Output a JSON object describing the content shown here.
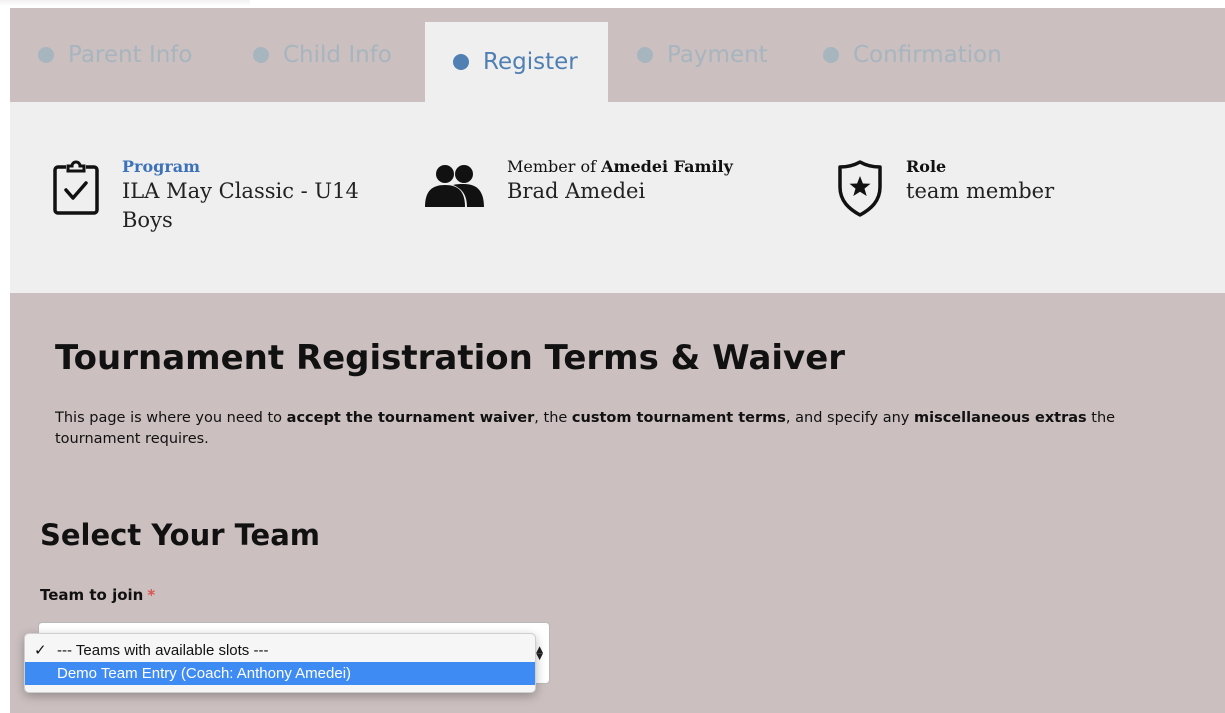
{
  "steps": [
    {
      "label": "Parent Info",
      "active": false
    },
    {
      "label": "Child Info",
      "active": false
    },
    {
      "label": "Register",
      "active": true
    },
    {
      "label": "Payment",
      "active": false
    },
    {
      "label": "Confirmation",
      "active": false
    }
  ],
  "info": {
    "program": {
      "label": "Program",
      "value": "ILA May Classic - U14 Boys",
      "icon": "clipboard-check-icon"
    },
    "member": {
      "prefix": "Member of",
      "family": "Amedei Family",
      "name": "Brad Amedei",
      "icon": "users-icon"
    },
    "role": {
      "label": "Role",
      "value": "team member",
      "icon": "shield-star-icon"
    }
  },
  "main": {
    "title": "Tournament Registration Terms & Waiver",
    "intro": {
      "t1": "This page is where you need to ",
      "b1": "accept the tournament waiver",
      "t2": ", the ",
      "b2": "custom tournament terms",
      "t3": ", and specify any ",
      "b3": "miscellaneous extras",
      "t4": " the tournament requires."
    },
    "section_title": "Select Your Team",
    "field_label": "Team to join",
    "required_mark": "*",
    "dropdown": {
      "options": [
        {
          "label": "--- Teams with available slots ---",
          "checked": true,
          "highlighted": false
        },
        {
          "label": "Demo Team Entry (Coach: Anthony Amedei)",
          "checked": false,
          "highlighted": true
        }
      ],
      "check_glyph": "✓"
    }
  },
  "colors": {
    "frame_bg": "#cbbfbf",
    "panel_bg": "#f0eff0",
    "active_step": "#4f7fb3",
    "inactive_step": "#a7b5bf",
    "highlight": "#3f8bf4",
    "required": "#d9534f"
  }
}
